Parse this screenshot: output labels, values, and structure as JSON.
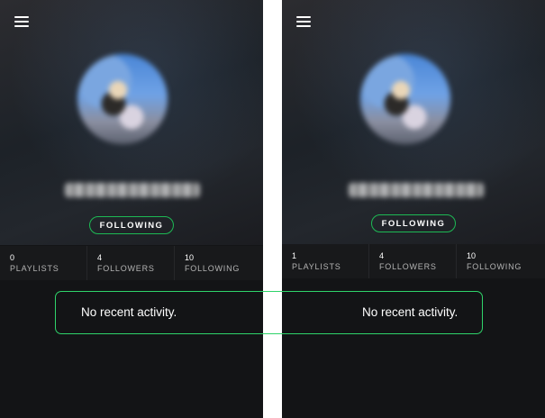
{
  "panels": [
    {
      "follow_button": "FOLLOWING",
      "stats": [
        {
          "value": "0",
          "label": "PLAYLISTS"
        },
        {
          "value": "4",
          "label": "FOLLOWERS"
        },
        {
          "value": "10",
          "label": "FOLLOWING"
        }
      ],
      "activity_text": "No recent activity."
    },
    {
      "follow_button": "FOLLOWING",
      "stats": [
        {
          "value": "1",
          "label": "PLAYLISTS"
        },
        {
          "value": "4",
          "label": "FOLLOWERS"
        },
        {
          "value": "10",
          "label": "FOLLOWING"
        }
      ],
      "activity_text": "No recent activity."
    }
  ],
  "icons": {
    "menu": "hamburger-menu-icon"
  },
  "colors": {
    "accent": "#1db954",
    "highlight": "#2fd36a",
    "background": "#131416"
  }
}
